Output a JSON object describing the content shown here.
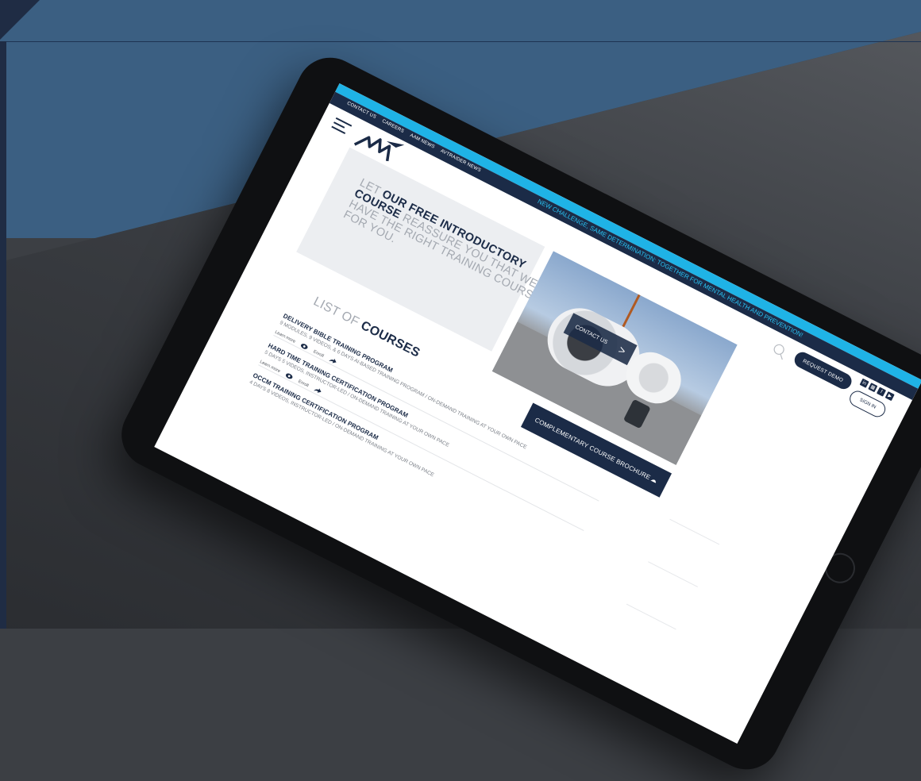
{
  "site": {
    "top_links": [
      "CONTACT US",
      "CAREERS",
      "AAM NEWS",
      "AVTRAIDER NEWS"
    ],
    "ticker": "NEW CHALLENGE, SAME DETERMINATION: TOGETHER FOR MENTAL HEALTH AND PREVENTION!",
    "request_demo": "REQUEST DEMO",
    "sign_in": "SIGN IN",
    "socials": [
      "in",
      "▦",
      "f",
      "▶"
    ]
  },
  "hero": {
    "let": "LET ",
    "bold": "OUR FREE INTRODUCTORY COURSE",
    "rest": " REASSURE YOU THAT WE HAVE THE RIGHT TRAINING COURSE FOR YOU.",
    "contact_label": "CONTACT US",
    "contact_chevron": ">",
    "brochure_label": "COMPLEMENTARY COURSE BROCHURE",
    "brochure_icon": "☁"
  },
  "list": {
    "title_light": "LIST OF ",
    "title_bold": "COURSES",
    "learn_more": "Learn more",
    "enroll": "Enroll",
    "courses": [
      {
        "title": "DELIVERY BIBLE TRAINING PROGRAM",
        "sub": "9 MODULES, 9 VIDEOS, & 6 DAYS AI-BASED TRAINING PROGRAM / ON-DEMAND TRAINING AT YOUR OWN PACE"
      },
      {
        "title": "HARD TIME TRAINING CERTIFICATION PROGRAM",
        "sub": "5 DAYS 5 VIDEOS, INSTRUCTOR-LED / ON-DEMAND TRAINING AT YOUR OWN PACE"
      },
      {
        "title": "OCCM TRAINING CERTIFICATION PROGRAM",
        "sub": "4 DAYS 8 VIDEOS, INSTRUCTOR-LED / ON-DEMAND TRAINING AT YOUR OWN PACE"
      }
    ]
  },
  "colors": {
    "navy": "#1b2b47",
    "cyan": "#1fb3e6",
    "backdrop_blue": "#3b5f82"
  }
}
